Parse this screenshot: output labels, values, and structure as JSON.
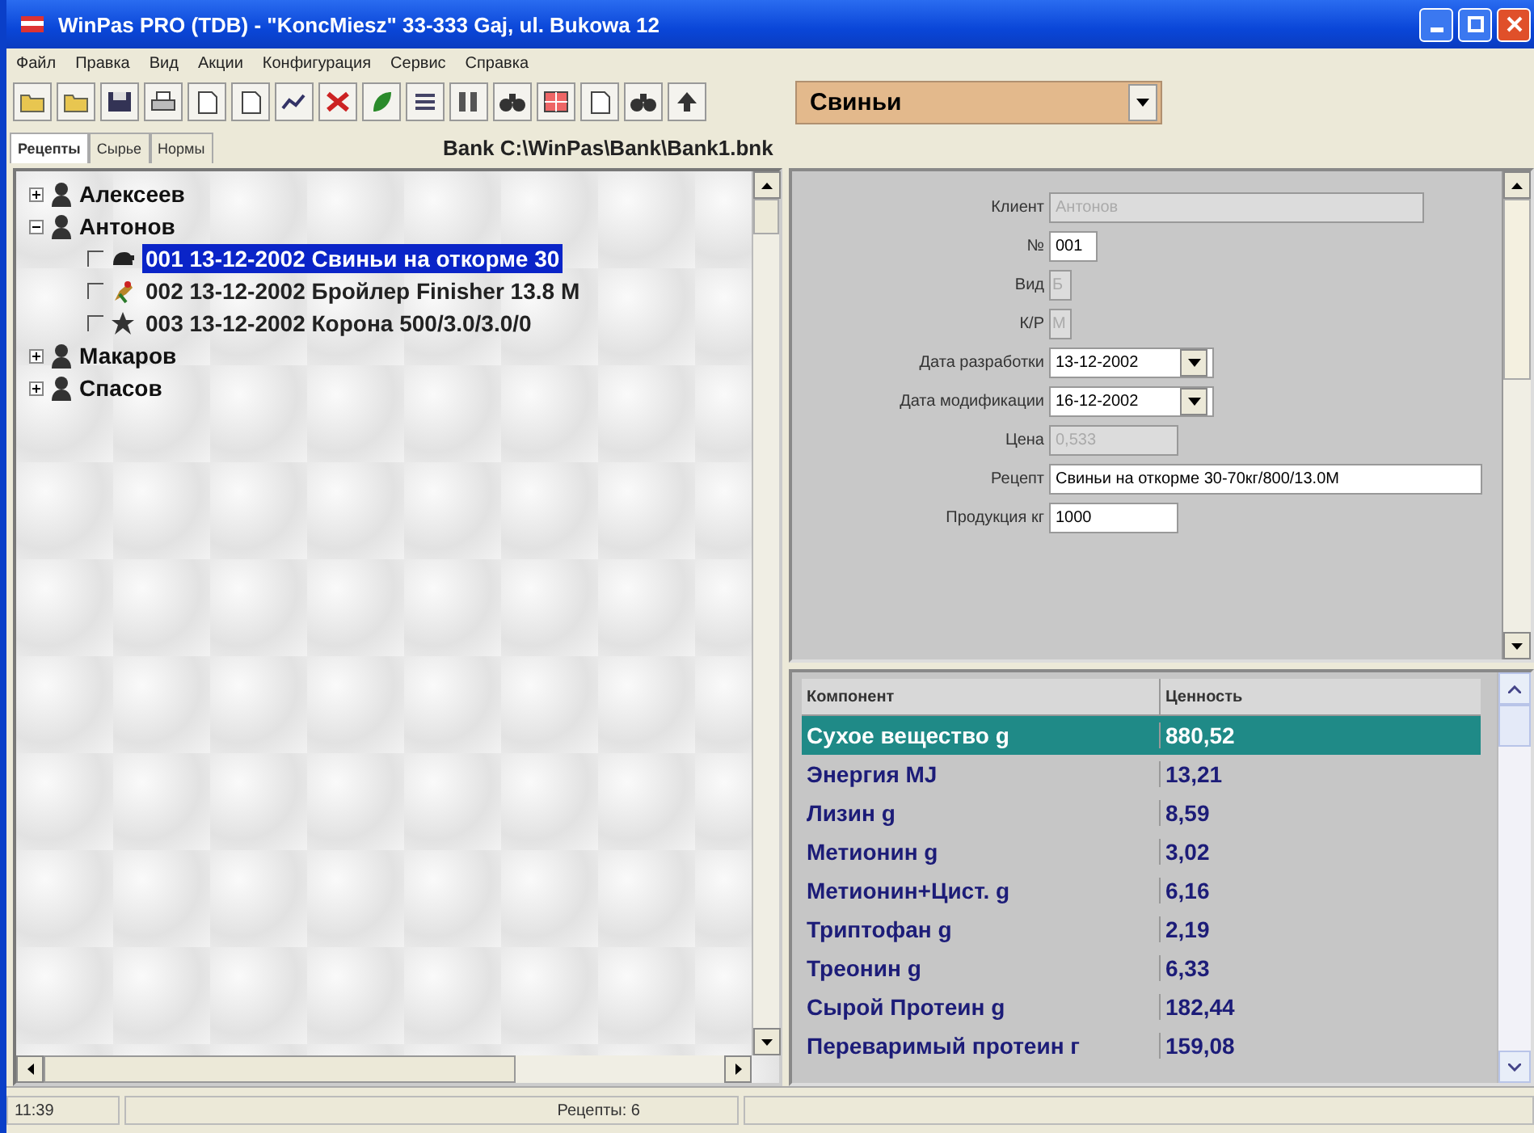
{
  "window": {
    "title": "WinPas PRO (TDB)  - \"KoncMiesz\"  33-333 Gaj, ul. Bukowa 12"
  },
  "menu": [
    "Файл",
    "Правка",
    "Вид",
    "Акции",
    "Конфигурация",
    "Сервис",
    "Справка"
  ],
  "species_combo": {
    "value": "Свиньи"
  },
  "tabs": [
    {
      "label": "Рецепты",
      "selected": true
    },
    {
      "label": "Сырье",
      "selected": false
    },
    {
      "label": "Нормы",
      "selected": false
    }
  ],
  "bank_path": "Bank C:\\WinPas\\Bank\\Bank1.bnk",
  "tree": [
    {
      "label": "Алексеев",
      "expanded": false
    },
    {
      "label": "Антонов",
      "expanded": true,
      "children": [
        {
          "label": "001 13-12-2002 Свиньи на откорме 30",
          "kind": "pig",
          "checked": false,
          "selected": true
        },
        {
          "label": "002 13-12-2002 Бройлер Finisher 13.8 M",
          "kind": "bird",
          "checked": false,
          "selected": false
        },
        {
          "label": "003 13-12-2002 Корона  500/3.0/3.0/0",
          "kind": "fish",
          "checked": false,
          "selected": false
        }
      ]
    },
    {
      "label": "Макаров",
      "expanded": false
    },
    {
      "label": "Спасов",
      "expanded": false
    }
  ],
  "form": [
    {
      "label": "Клиент",
      "value": "Антонов",
      "kind": "wide",
      "disabled": true
    },
    {
      "label": "№",
      "value": "001",
      "kind": "short",
      "disabled": false
    },
    {
      "label": "Вид",
      "value": "Б",
      "kind": "tiny",
      "disabled": true
    },
    {
      "label": "К/Р",
      "value": "М",
      "kind": "tiny",
      "disabled": true
    },
    {
      "label": "Дата разработки",
      "value": "13-12-2002",
      "kind": "date",
      "disabled": false
    },
    {
      "label": "Дата модификации",
      "value": "16-12-2002",
      "kind": "date",
      "disabled": false
    },
    {
      "label": "Цена",
      "value": "0,533",
      "kind": "number",
      "disabled": true
    },
    {
      "label": "Рецепт",
      "value": "Свиньи на откорме 30-70кг/800/13.0М",
      "kind": "long",
      "disabled": false
    },
    {
      "label": "Продукция кг",
      "value": "1000",
      "kind": "number",
      "disabled": false
    }
  ],
  "grid": {
    "columns": [
      "Компонент",
      "Ценность"
    ],
    "rows": [
      {
        "cells": [
          "Сухое вещество g",
          "880,52"
        ],
        "selected": true
      },
      {
        "cells": [
          "Энергия MJ",
          "13,21"
        ],
        "selected": false
      },
      {
        "cells": [
          "Лизин g",
          "8,59"
        ],
        "selected": false
      },
      {
        "cells": [
          "Метионин g",
          "3,02"
        ],
        "selected": false
      },
      {
        "cells": [
          "Метионин+Цист. g",
          "6,16"
        ],
        "selected": false
      },
      {
        "cells": [
          "Триптофан g",
          "2,19"
        ],
        "selected": false
      },
      {
        "cells": [
          "Треонин g",
          "6,33"
        ],
        "selected": false
      },
      {
        "cells": [
          "Сырой Протеин g",
          "182,44"
        ],
        "selected": false
      },
      {
        "cells": [
          "Переваримый протеин г",
          "159,08"
        ],
        "selected": false
      }
    ]
  },
  "status_bar": {
    "time": "11:39",
    "text": "Рецепты: 6"
  }
}
